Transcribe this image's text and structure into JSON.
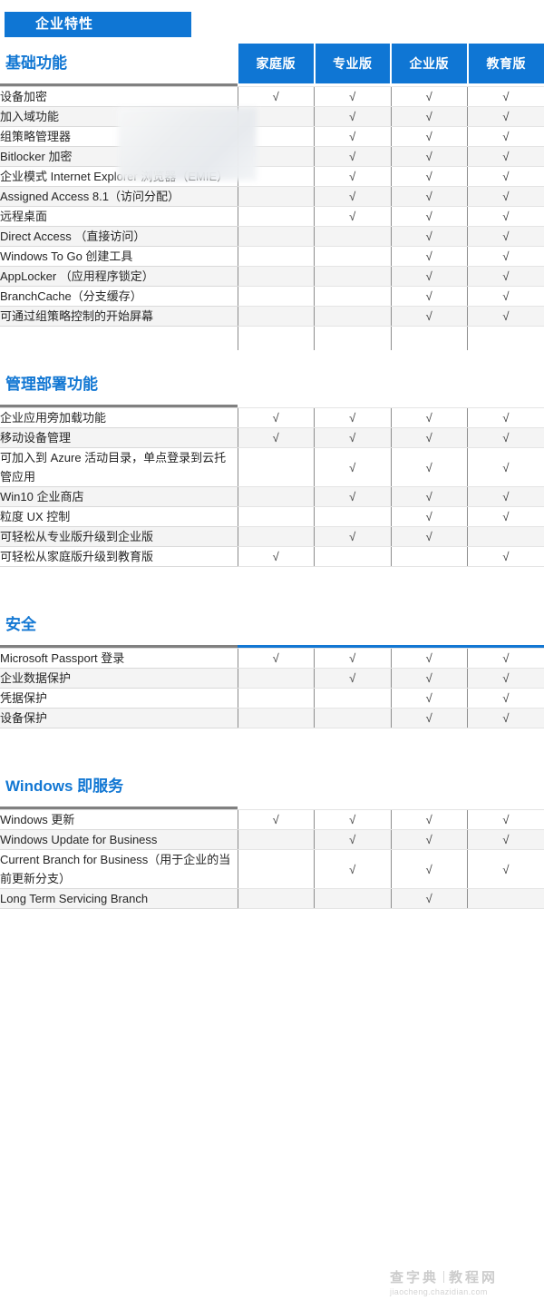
{
  "badge": {
    "label": "企业特性"
  },
  "columns": [
    {
      "key": "home",
      "label": "家庭版"
    },
    {
      "key": "pro",
      "label": "专业版"
    },
    {
      "key": "enterprise",
      "label": "企业版"
    },
    {
      "key": "education",
      "label": "教育版"
    }
  ],
  "check_glyph": "√",
  "colors": {
    "brand_blue": "#0f76d4",
    "heading_blue": "#1277d3",
    "row_alt": "#f4f4f4",
    "rule_grey": "#808080",
    "border_grey": "#8c8c8c"
  },
  "sections": [
    {
      "title": "基础功能",
      "rule": "grey",
      "has_column_headers": true,
      "rows": [
        {
          "feature": "设备加密",
          "marks": [
            true,
            true,
            true,
            true
          ]
        },
        {
          "feature": "加入域功能",
          "marks": [
            false,
            true,
            true,
            true
          ]
        },
        {
          "feature": "组策略管理器",
          "marks": [
            false,
            true,
            true,
            true
          ]
        },
        {
          "feature": "Bitlocker 加密",
          "marks": [
            false,
            true,
            true,
            true
          ]
        },
        {
          "feature": "企业模式 Internet Explorer 浏览器（EMIE）",
          "marks": [
            false,
            true,
            true,
            true
          ]
        },
        {
          "feature": "Assigned Access 8.1（访问分配）",
          "marks": [
            false,
            true,
            true,
            true
          ]
        },
        {
          "feature": "远程桌面",
          "marks": [
            false,
            true,
            true,
            true
          ]
        },
        {
          "feature": "Direct Access （直接访问）",
          "marks": [
            false,
            false,
            true,
            true
          ]
        },
        {
          "feature": "Windows To Go 创建工具",
          "marks": [
            false,
            false,
            true,
            true
          ]
        },
        {
          "feature": "AppLocker （应用程序锁定）",
          "marks": [
            false,
            false,
            true,
            true
          ]
        },
        {
          "feature": "BranchCache（分支缓存）",
          "marks": [
            false,
            false,
            true,
            true
          ]
        },
        {
          "feature": "可通过组策略控制的开始屏幕",
          "marks": [
            false,
            false,
            true,
            true
          ]
        }
      ]
    },
    {
      "title": "管理部署功能",
      "rule": "grey",
      "has_column_headers": false,
      "rows": [
        {
          "feature": "企业应用旁加载功能",
          "marks": [
            true,
            true,
            true,
            true
          ]
        },
        {
          "feature": "移动设备管理",
          "marks": [
            true,
            true,
            true,
            true
          ]
        },
        {
          "feature": "可加入到 Azure 活动目录，单点登录到云托管应用",
          "marks": [
            false,
            true,
            true,
            true
          ]
        },
        {
          "feature": "Win10 企业商店",
          "marks": [
            false,
            true,
            true,
            true
          ]
        },
        {
          "feature": "粒度 UX 控制",
          "marks": [
            false,
            false,
            true,
            true
          ]
        },
        {
          "feature": "可轻松从专业版升级到企业版",
          "marks": [
            false,
            true,
            true,
            false
          ]
        },
        {
          "feature": "可轻松从家庭版升级到教育版",
          "marks": [
            true,
            false,
            false,
            true
          ]
        }
      ]
    },
    {
      "title": "安全",
      "rule": "blue",
      "has_column_headers": false,
      "rows": [
        {
          "feature": "Microsoft Passport 登录",
          "marks": [
            true,
            true,
            true,
            true
          ]
        },
        {
          "feature": "企业数据保护",
          "marks": [
            false,
            true,
            true,
            true
          ]
        },
        {
          "feature": "凭据保护",
          "marks": [
            false,
            false,
            true,
            true
          ]
        },
        {
          "feature": "设备保护",
          "marks": [
            false,
            false,
            true,
            true
          ]
        }
      ]
    },
    {
      "title": "Windows 即服务",
      "rule": "grey",
      "has_column_headers": false,
      "rows": [
        {
          "feature": "Windows 更新",
          "marks": [
            true,
            true,
            true,
            true
          ]
        },
        {
          "feature": "Windows Update for Business",
          "marks": [
            false,
            true,
            true,
            true
          ]
        },
        {
          "feature": "Current Branch for Business（用于企业的当前更新分支）",
          "marks": [
            false,
            true,
            true,
            true
          ]
        },
        {
          "feature": "Long Term Servicing Branch",
          "marks": [
            false,
            false,
            true,
            false
          ]
        }
      ]
    }
  ],
  "watermark": {
    "brand": "查字典",
    "site": "教程网",
    "url": "jiaocheng.chazidian.com"
  }
}
